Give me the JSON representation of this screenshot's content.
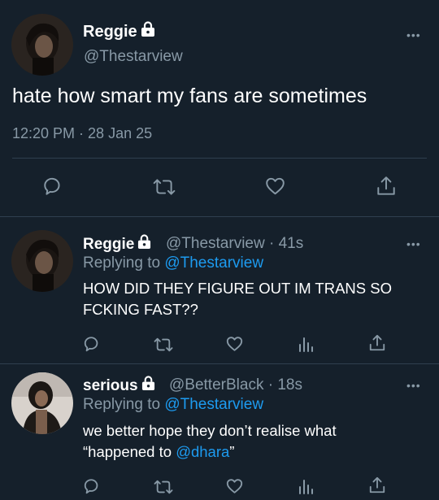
{
  "main_tweet": {
    "display_name": "Reggie",
    "handle": "@Thestarview",
    "text": "hate how smart my fans are sometimes",
    "timestamp": "12:20 PM · 28 Jan 25",
    "more": "•••"
  },
  "replies": [
    {
      "display_name": "Reggie",
      "handle_time": "@Thestarview · 41s",
      "replying_label": "Replying to",
      "replying_to": "@Thestarview",
      "text_line1": "HOW DID THEY FIGURE OUT IM TRANS SO",
      "text_line2": "FCKING FAST??",
      "more": "•••"
    },
    {
      "display_name": "serious",
      "handle_time": "@BetterBlack · 18s",
      "replying_label": "Replying to",
      "replying_to": "@Thestarview",
      "text_line1": "we better hope they don’t realise what",
      "text_line2_pre": "“happened to ",
      "text_line2_mention": "@dhara",
      "text_line2_post": "”",
      "more": "•••"
    }
  ],
  "colors": {
    "background": "#15202b",
    "muted": "#8899a6",
    "link": "#1d9bf0",
    "divider": "#2f3f4f"
  },
  "icons": [
    "lock-icon",
    "reply-icon",
    "retweet-icon",
    "like-icon",
    "share-icon",
    "analytics-icon",
    "more-icon"
  ]
}
